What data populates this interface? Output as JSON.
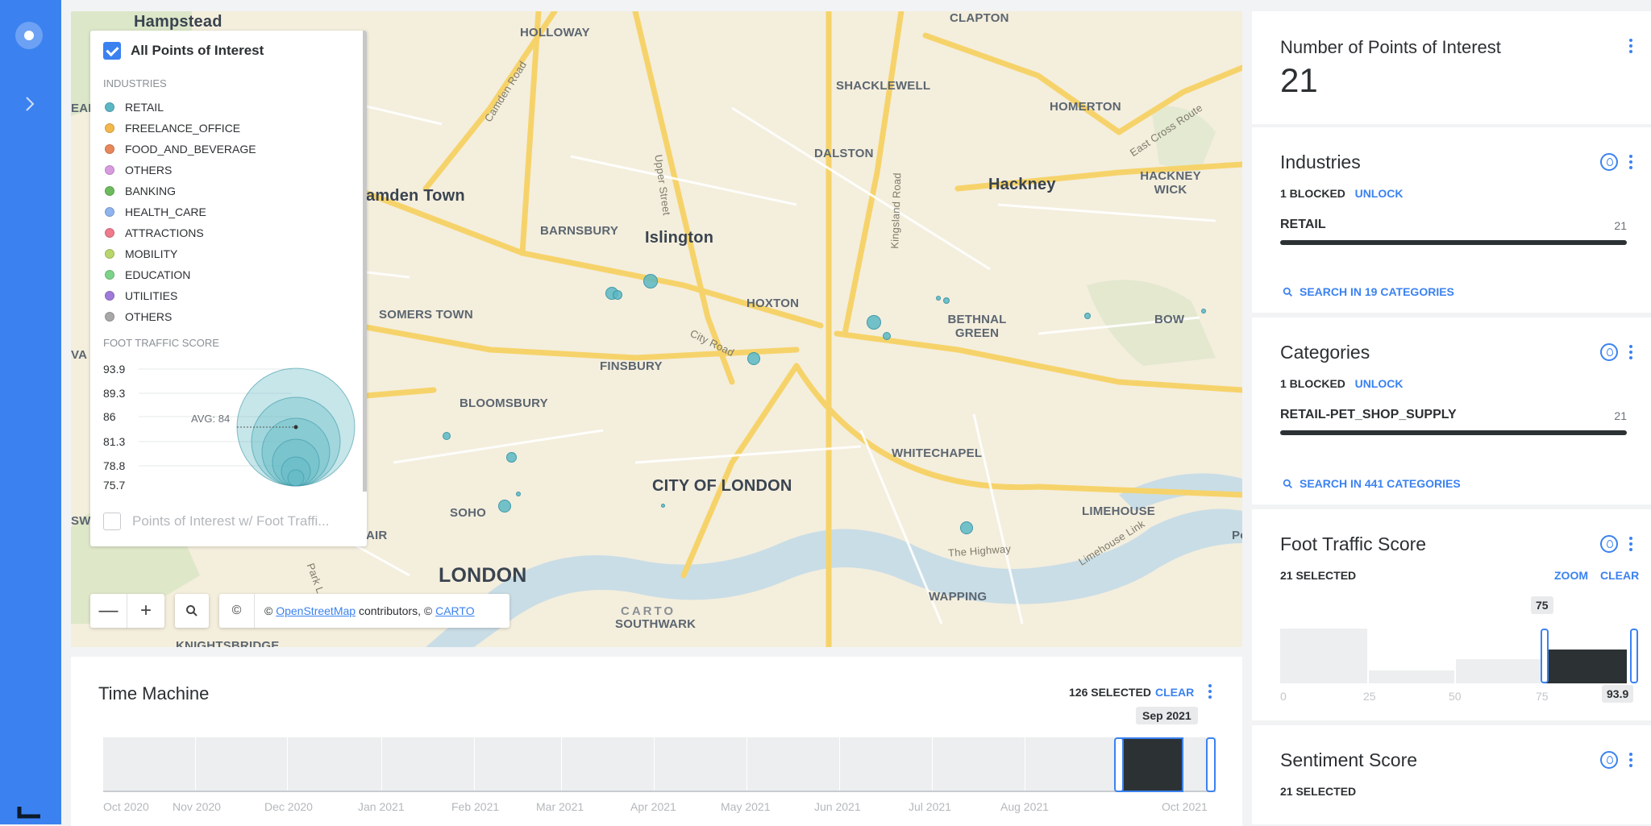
{
  "map": {
    "places": [
      {
        "name": "Hampstead",
        "cls": "mid"
      },
      {
        "name": "HOLLOWAY",
        "cls": ""
      },
      {
        "name": "CLAPTON",
        "cls": ""
      },
      {
        "name": "SHACKLEWELL",
        "cls": ""
      },
      {
        "name": "HOMERTON",
        "cls": ""
      },
      {
        "name": "DALSTON",
        "cls": ""
      },
      {
        "name": "Hackney",
        "cls": "mid"
      },
      {
        "name": "HACKNEY WICK",
        "cls": ""
      },
      {
        "name": "amden Town",
        "cls": "mid"
      },
      {
        "name": "BARNSBURY",
        "cls": ""
      },
      {
        "name": "Islington",
        "cls": "mid"
      },
      {
        "name": "SOMERS TOWN",
        "cls": ""
      },
      {
        "name": "HOXTON",
        "cls": ""
      },
      {
        "name": "BETHNAL GREEN",
        "cls": ""
      },
      {
        "name": "BOW",
        "cls": ""
      },
      {
        "name": "FINSBURY",
        "cls": ""
      },
      {
        "name": "BLOOMSBURY",
        "cls": ""
      },
      {
        "name": "WHITECHAPEL",
        "cls": ""
      },
      {
        "name": "CITY OF LONDON",
        "cls": "mid"
      },
      {
        "name": "SOHO",
        "cls": ""
      },
      {
        "name": "LIMEHOUSE",
        "cls": ""
      },
      {
        "name": "LONDON",
        "cls": "big"
      },
      {
        "name": "WAPPING",
        "cls": ""
      },
      {
        "name": "SOUTHWARK",
        "cls": ""
      },
      {
        "name": "KNIGHTSBRIDGE",
        "cls": ""
      },
      {
        "name": "Camden Road",
        "cls": "road"
      },
      {
        "name": "Upper Street",
        "cls": "road"
      },
      {
        "name": "Kingsland Road",
        "cls": "road"
      },
      {
        "name": "East Cross Route",
        "cls": "road"
      },
      {
        "name": "City Road",
        "cls": "road"
      },
      {
        "name": "The Highway",
        "cls": "road"
      },
      {
        "name": "Limehouse Link",
        "cls": "road"
      },
      {
        "name": "Park L",
        "cls": "road"
      },
      {
        "name": "EAD",
        "cls": ""
      },
      {
        "name": "VA",
        "cls": ""
      },
      {
        "name": "SW",
        "cls": ""
      },
      {
        "name": "AIR",
        "cls": ""
      },
      {
        "name": "Po",
        "cls": ""
      }
    ],
    "carto_mark": "CARTO",
    "zoom_out": "—",
    "zoom_in": "+",
    "copyright_symbol": "©",
    "attribution": {
      "prefix": "©",
      "osm": "OpenStreetMap",
      "middle": "contributors, ©",
      "carto": "CARTO"
    }
  },
  "legend": {
    "all_poi_label": "All Points of Interest",
    "industries_heading": "INDUSTRIES",
    "industries": [
      {
        "label": "RETAIL",
        "color": "#5bb7c4"
      },
      {
        "label": "FREELANCE_OFFICE",
        "color": "#f2b84b"
      },
      {
        "label": "FOOD_AND_BEVERAGE",
        "color": "#e8875a"
      },
      {
        "label": "OTHERS",
        "color": "#d99be0"
      },
      {
        "label": "BANKING",
        "color": "#6dbb5c"
      },
      {
        "label": "HEALTH_CARE",
        "color": "#8fb4f0"
      },
      {
        "label": "ATTRACTIONS",
        "color": "#ef7a8c"
      },
      {
        "label": "MOBILITY",
        "color": "#b8d66a"
      },
      {
        "label": "EDUCATION",
        "color": "#7ed38a"
      },
      {
        "label": "UTILITIES",
        "color": "#a07ad8"
      },
      {
        "label": "OTHERS",
        "color": "#a8a8a8"
      }
    ],
    "foot_traffic_heading": "FOOT TRAFFIC SCORE",
    "foot_traffic_values": [
      "93.9",
      "89.3",
      "86",
      "81.3",
      "78.8",
      "75.7"
    ],
    "avg_label": "AVG: 84",
    "second_layer_label": "Points of Interest w/ Foot Traffi..."
  },
  "time_machine": {
    "title": "Time Machine",
    "selected_count": "126 SELECTED",
    "clear_label": "CLEAR",
    "tooltip": "Sep 2021",
    "ticks": [
      "Oct 2020",
      "Nov 2020",
      "Dec 2020",
      "Jan 2021",
      "Feb 2021",
      "Mar 2021",
      "Apr 2021",
      "May 2021",
      "Jun 2021",
      "Jul 2021",
      "Aug 2021",
      "Oct 2021"
    ]
  },
  "widgets": {
    "poi_count": {
      "title": "Number of Points of Interest",
      "value": "21"
    },
    "industries": {
      "title": "Industries",
      "blocked": "1 BLOCKED",
      "unlock": "UNLOCK",
      "item": "RETAIL",
      "item_value": "21",
      "search": "SEARCH IN 19 CATEGORIES"
    },
    "categories": {
      "title": "Categories",
      "blocked": "1 BLOCKED",
      "unlock": "UNLOCK",
      "item": "RETAIL-PET_SHOP_SUPPLY",
      "item_value": "21",
      "search": "SEARCH IN 441 CATEGORIES"
    },
    "foot_traffic": {
      "title": "Foot Traffic Score",
      "selected": "21 SELECTED",
      "zoom": "ZOOM",
      "clear": "CLEAR",
      "tip": "75",
      "max": "93.9",
      "ticks": [
        "0",
        "25",
        "50",
        "75"
      ]
    },
    "sentiment": {
      "title": "Sentiment Score",
      "selected": "21 SELECTED"
    }
  },
  "colors": {
    "accent": "#3b82f0",
    "dark": "#2c3234",
    "poi": "#5bb7c4"
  }
}
